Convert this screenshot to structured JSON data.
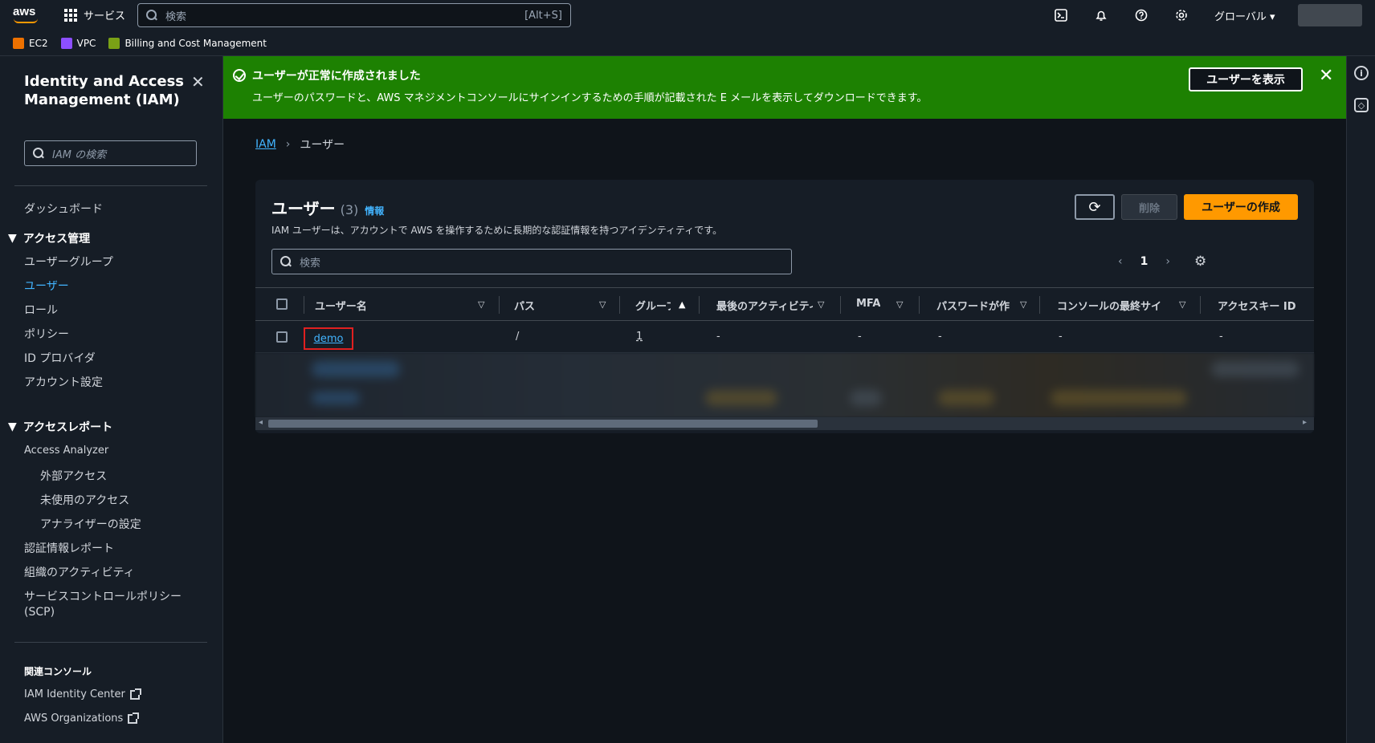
{
  "topbar": {
    "logo": "aws",
    "services_label": "サービス",
    "search_placeholder": "検索",
    "search_shortcut": "[Alt+S]",
    "region_label": "グローバル ▾",
    "icons": [
      "cloudshell-icon",
      "bell-icon",
      "help-icon",
      "settings-icon"
    ]
  },
  "favorites": [
    {
      "label": "EC2",
      "color": "#ed7100"
    },
    {
      "label": "VPC",
      "color": "#8c4fff"
    },
    {
      "label": "Billing and Cost Management",
      "color": "#7aa116"
    }
  ],
  "sidebar": {
    "title": "Identity and Access Management (IAM)",
    "search_placeholder": "IAM の検索",
    "dashboard": "ダッシュボード",
    "section_access": "アクセス管理",
    "access_items": [
      "ユーザーグループ",
      "ユーザー",
      "ロール",
      "ポリシー",
      "ID プロバイダ",
      "アカウント設定"
    ],
    "section_reports": "アクセスレポート",
    "analyzer": "Access Analyzer",
    "analyzer_items": [
      "外部アクセス",
      "未使用のアクセス",
      "アナライザーの設定"
    ],
    "report_items": [
      "認証情報レポート",
      "組織のアクティビティ",
      "サービスコントロールポリシー",
      "(SCP)"
    ],
    "related_title": "関連コンソール",
    "related_links": [
      "IAM Identity Center",
      "AWS Organizations"
    ]
  },
  "flash": {
    "title": "ユーザーが正常に作成されました",
    "text": "ユーザーのパスワードと、AWS マネジメントコンソールにサインインするための手順が記載された E メールを表示してダウンロードできます。",
    "button": "ユーザーを表示"
  },
  "breadcrumb": {
    "root": "IAM",
    "current": "ユーザー"
  },
  "users_panel": {
    "title": "ユーザー",
    "count": "(3)",
    "info": "情報",
    "description": "IAM ユーザーは、アカウントで AWS を操作するために長期的な認証情報を持つアイデンティティです。",
    "delete_label": "削除",
    "create_label": "ユーザーの作成",
    "search_placeholder": "検索",
    "page": "1",
    "columns": [
      "ユーザー名",
      "パス",
      "グループ",
      "最後のアクティビティ",
      "MFA",
      "パスワードが作",
      "コンソールの最終サイ",
      "アクセスキー ID"
    ],
    "rows": [
      {
        "name": "demo",
        "path": "/",
        "groups": "1",
        "last_activity": "-",
        "mfa": "-",
        "password_age": "-",
        "console_last": "-",
        "access_key": "-"
      }
    ]
  }
}
